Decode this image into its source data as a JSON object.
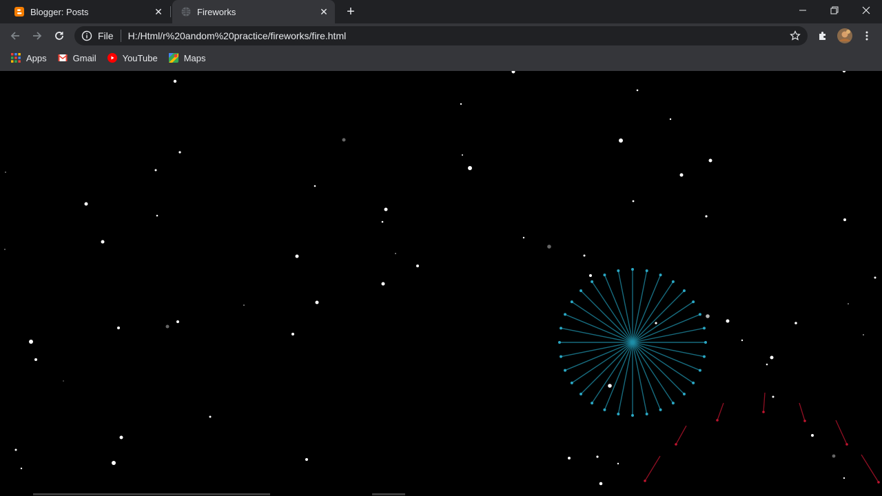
{
  "tabs": [
    {
      "title": "Blogger: Posts",
      "favicon": "blogger-icon",
      "active": false
    },
    {
      "title": "Fireworks",
      "favicon": "globe-icon",
      "active": true
    }
  ],
  "toolbar": {
    "scheme_label": "File",
    "url": "H:/Html/r%20andom%20practice/fireworks/fire.html"
  },
  "bookmarks": [
    {
      "label": "Apps",
      "icon": "apps-grid-icon"
    },
    {
      "label": "Gmail",
      "icon": "gmail-icon"
    },
    {
      "label": "YouTube",
      "icon": "youtube-icon"
    },
    {
      "label": "Maps",
      "icon": "maps-icon"
    }
  ],
  "colors": {
    "background": "#000000",
    "firework_burst": "#1f8fa8",
    "rocket_trail": "#c0152f",
    "star": "#ffffff"
  }
}
